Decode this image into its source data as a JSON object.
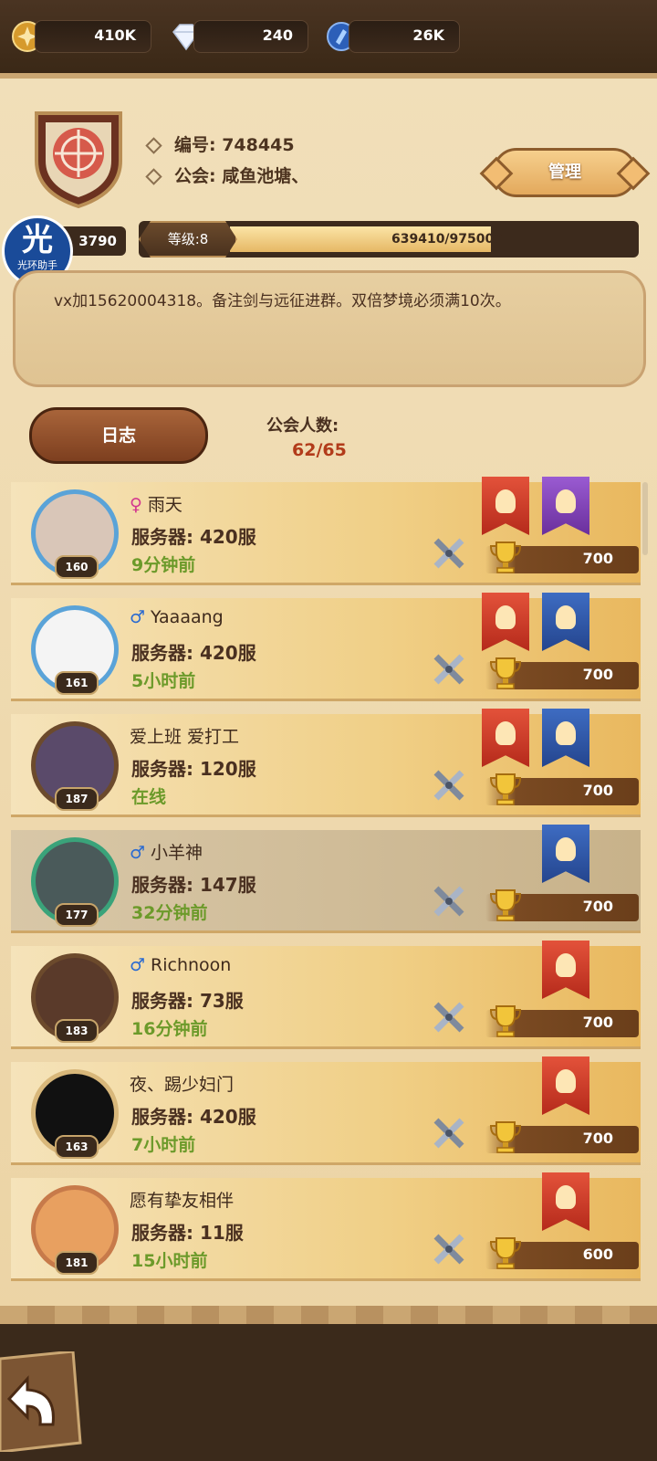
{
  "currencies": [
    {
      "name": "gold",
      "icon": "gold-coin-icon",
      "value": "410K"
    },
    {
      "name": "diamonds",
      "icon": "diamond-icon",
      "value": "240"
    },
    {
      "name": "dust",
      "icon": "blue-crystal-icon",
      "value": "26K"
    }
  ],
  "guild": {
    "id_label": "编号: 748445",
    "name_label": "公会: 咸鱼池塘、",
    "manage_label": "管理",
    "id_box": "3790",
    "level_label": "等级:8",
    "exp_text": "639410/975000",
    "exp_progress": 0.6558,
    "notice": "vx加15620004318。备注剑与远征进群。双倍梦境必须满10次。",
    "log_label": "日志",
    "member_count_label": "公会人数:",
    "member_count": "62/65"
  },
  "watermark": {
    "big": "光",
    "small": "光环助手"
  },
  "members": [
    {
      "gender": "female",
      "gender_icon": "female-icon",
      "name": "雨天",
      "server": "服务器: 420服",
      "time": "9分钟前",
      "level": "160",
      "points": "700",
      "banners": [
        "red",
        "purple"
      ],
      "selected": false
    },
    {
      "gender": "male",
      "gender_icon": "male-icon",
      "name": "Yaaaang",
      "server": "服务器: 420服",
      "time": "5小时前",
      "level": "161",
      "points": "700",
      "banners": [
        "red",
        "blue"
      ],
      "selected": false
    },
    {
      "gender": "",
      "gender_icon": "",
      "name": "爱上班 爱打工",
      "server": "服务器: 120服",
      "time": "在线",
      "level": "187",
      "points": "700",
      "banners": [
        "red",
        "blue"
      ],
      "selected": false
    },
    {
      "gender": "male",
      "gender_icon": "male-icon",
      "name": "小羊神",
      "server": "服务器: 147服",
      "time": "32分钟前",
      "level": "177",
      "points": "700",
      "banners": [
        "blue"
      ],
      "selected": true
    },
    {
      "gender": "male",
      "gender_icon": "male-icon",
      "name": "Richnoon",
      "server": "服务器: 73服",
      "time": "16分钟前",
      "level": "183",
      "points": "700",
      "banners": [
        "red"
      ],
      "selected": false
    },
    {
      "gender": "",
      "gender_icon": "",
      "name": "夜、踢少妇门",
      "server": "服务器: 420服",
      "time": "7小时前",
      "level": "163",
      "points": "700",
      "banners": [
        "red"
      ],
      "selected": false
    },
    {
      "gender": "",
      "gender_icon": "",
      "name": "愿有挚友相伴",
      "server": "服务器: 11服",
      "time": "15小时前",
      "level": "181",
      "points": "600",
      "banners": [
        "red"
      ],
      "selected": false
    }
  ],
  "colors": {
    "online_green": "#6c9a2a",
    "count_red": "#b23b1a",
    "male_blue": "#2a6ad1",
    "female_pink": "#d3378f"
  }
}
